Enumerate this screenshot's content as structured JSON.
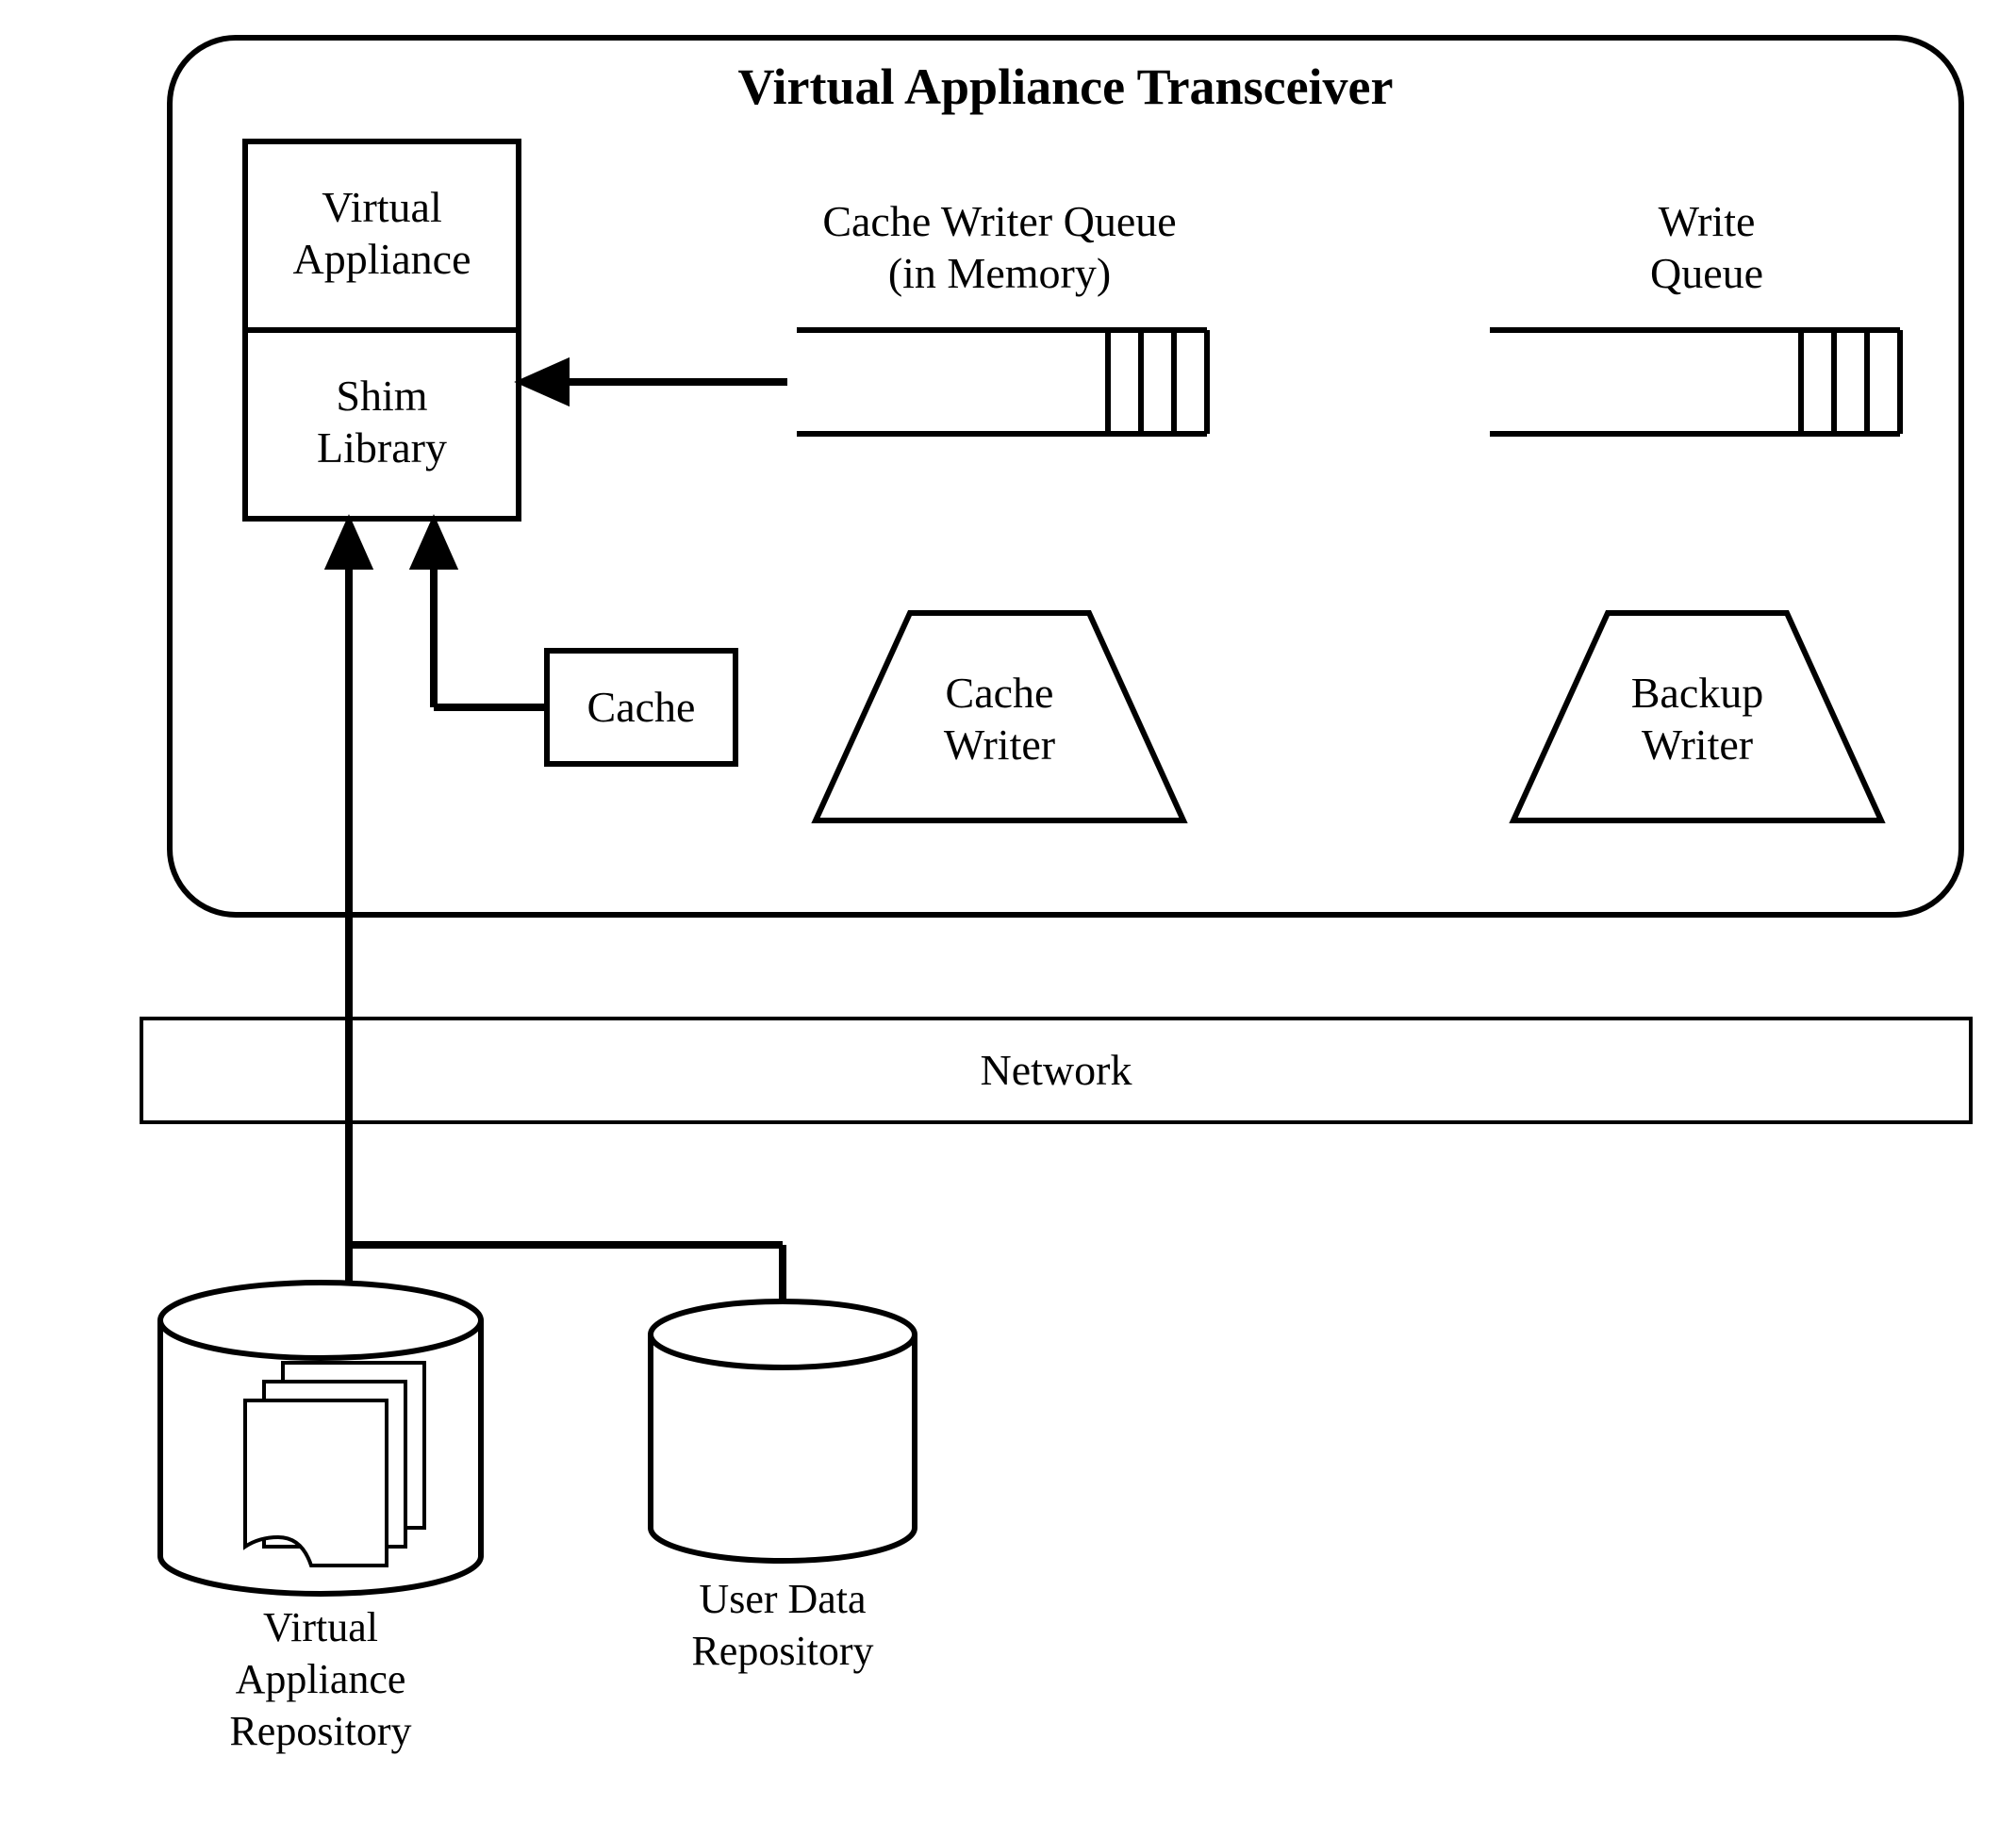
{
  "diagram": {
    "container_title": "Virtual Appliance Transceiver",
    "virtual_appliance_box": {
      "top_label_line1": "Virtual",
      "top_label_line2": "Appliance",
      "bottom_label_line1": "Shim",
      "bottom_label_line2": "Library"
    },
    "cache_writer_queue": {
      "label_line1": "Cache Writer Queue",
      "label_line2": "(in Memory)"
    },
    "write_queue": {
      "label_line1": "Write",
      "label_line2": "Queue"
    },
    "cache_box": "Cache",
    "cache_writer_trap": {
      "line1": "Cache",
      "line2": "Writer"
    },
    "backup_writer_trap": {
      "line1": "Backup",
      "line2": "Writer"
    },
    "network_label": "Network",
    "va_repo": {
      "line1": "Virtual",
      "line2": "Appliance",
      "line3": "Repository"
    },
    "user_repo": {
      "line1": "User Data",
      "line2": "Repository"
    }
  }
}
